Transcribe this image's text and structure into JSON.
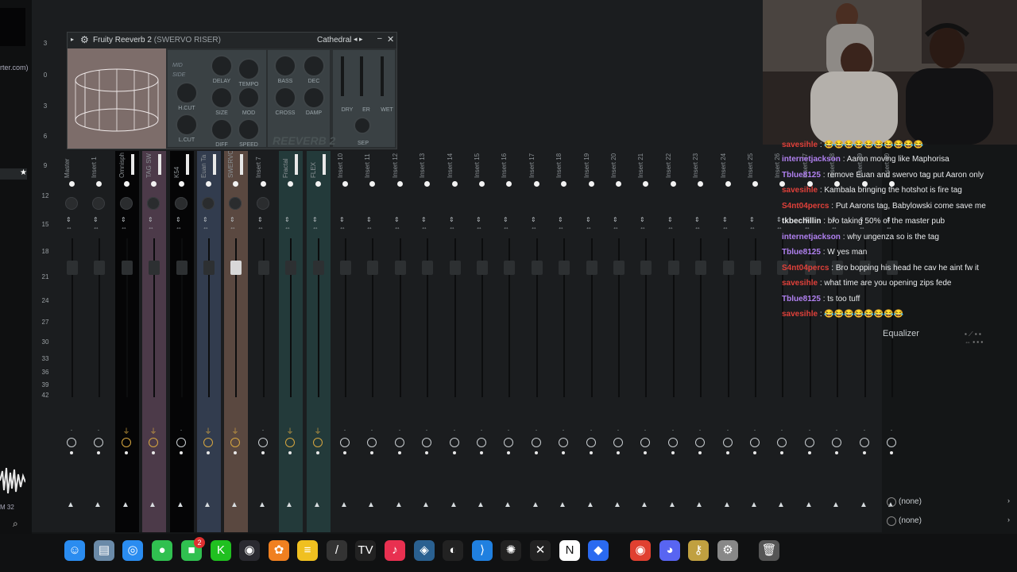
{
  "left_panel": {
    "url_fragment": "rter.com)",
    "star_glyph": "★",
    "zoom_label": "M 32"
  },
  "db_scale": [
    "3",
    "0",
    "3",
    "6",
    "9",
    "12",
    "15",
    "18",
    "21",
    "24",
    "27",
    "30",
    "33",
    "36",
    "39",
    "42"
  ],
  "plugin": {
    "title": "Fruity Reeverb 2",
    "channel": "(SWERVO RISER)",
    "preset": "Cathedral",
    "mode_mid": "MID",
    "mode_side": "SIDE",
    "knob_labels": [
      "DELAY",
      "TEMPO",
      "H.CUT",
      "SIZE",
      "MOD",
      "L.CUT",
      "DIFF",
      "SPEED",
      "BASS",
      "DEC",
      "CROSS",
      "DAMP",
      "DRY",
      "ER",
      "WET"
    ],
    "sep_label": "SEP",
    "brand": "REEVERB 2"
  },
  "mixer": {
    "strips": [
      {
        "name": "Master",
        "color": "dark"
      },
      {
        "name": "Insert 1",
        "color": "dark"
      },
      {
        "name": "Omnisph",
        "color": "black"
      },
      {
        "name": "TAG SW",
        "color": "pink"
      },
      {
        "name": "K54",
        "color": "black"
      },
      {
        "name": "Euan Ta",
        "color": "blue"
      },
      {
        "name": "SWERVO",
        "color": "brown"
      },
      {
        "name": "Insert 7",
        "color": "dark"
      },
      {
        "name": "Fractal",
        "color": "teal"
      },
      {
        "name": "FLEX",
        "color": "teal"
      },
      {
        "name": "Insert 10",
        "color": "dark"
      },
      {
        "name": "Insert 11",
        "color": "dark"
      },
      {
        "name": "Insert 12",
        "color": "dark"
      },
      {
        "name": "Insert 13",
        "color": "dark"
      },
      {
        "name": "Insert 14",
        "color": "dark"
      },
      {
        "name": "Insert 15",
        "color": "dark"
      },
      {
        "name": "Insert 16",
        "color": "dark"
      },
      {
        "name": "Insert 17",
        "color": "dark"
      },
      {
        "name": "Insert 18",
        "color": "dark"
      },
      {
        "name": "Insert 19",
        "color": "dark"
      },
      {
        "name": "Insert 20",
        "color": "dark"
      },
      {
        "name": "Insert 21",
        "color": "dark"
      },
      {
        "name": "Insert 22",
        "color": "dark"
      },
      {
        "name": "Insert 23",
        "color": "dark"
      },
      {
        "name": "Insert 24",
        "color": "dark"
      },
      {
        "name": "Insert 25",
        "color": "dark"
      },
      {
        "name": "Insert 26",
        "color": "dark"
      },
      {
        "name": "Insert 27",
        "color": "dark"
      },
      {
        "name": "Insert 28",
        "color": "dark"
      },
      {
        "name": "Insert 29",
        "color": "dark"
      },
      {
        "name": "Insert 30",
        "color": "dark"
      }
    ]
  },
  "chat": [
    {
      "user": "savesihle",
      "color": "#e0403a",
      "text": "😂😂😂😂😂😂😂😂😂😂"
    },
    {
      "user": "internetjackson",
      "color": "#b080f0",
      "text": "Aaron moving like Maphorisa"
    },
    {
      "user": "Tblue8125",
      "color": "#b080f0",
      "text": "remove Euan and swervo tag put Aaron only"
    },
    {
      "user": "savesihle",
      "color": "#e0403a",
      "text": "Kambala bringing the hotshot is fire tag"
    },
    {
      "user": "S4nt04percs",
      "color": "#e0403a",
      "text": "Put Aarons tag, Babylowski come save me"
    },
    {
      "user": "tkbechillin",
      "color": "#e8eaec",
      "text": "bro taking 50% of the master pub"
    },
    {
      "user": "internetjackson",
      "color": "#b080f0",
      "text": "why ungenza so is the tag"
    },
    {
      "user": "Tblue8125",
      "color": "#b080f0",
      "text": "W yes man"
    },
    {
      "user": "S4nt04percs",
      "color": "#e0403a",
      "text": "Bro bopping his head he cav he aint fw it"
    },
    {
      "user": "savesihle",
      "color": "#e0403a",
      "text": "what time are you opening zips fede"
    },
    {
      "user": "Tblue8125",
      "color": "#b080f0",
      "text": "ts too tuff"
    },
    {
      "user": "savesihle",
      "color": "#e0403a",
      "text": "😂😂😂😂😂😂😂😂"
    }
  ],
  "right_panel": {
    "eq_label": "Equalizer",
    "slot1": "(none)",
    "slot2": "(none)"
  },
  "dock": [
    {
      "name": "finder",
      "glyph": "☺",
      "color": "#2a8cf0"
    },
    {
      "name": "files",
      "glyph": "▤",
      "color": "#6a8aa8"
    },
    {
      "name": "safari",
      "glyph": "◎",
      "color": "#2a8cf0"
    },
    {
      "name": "messages",
      "glyph": "●",
      "color": "#30c050"
    },
    {
      "name": "facetime",
      "glyph": "■",
      "color": "#30c050"
    },
    {
      "name": "kick",
      "glyph": "K",
      "color": "#20c020"
    },
    {
      "name": "obs",
      "glyph": "◉",
      "color": "#2a2a30"
    },
    {
      "name": "fl-studio",
      "glyph": "✿",
      "color": "#f08020"
    },
    {
      "name": "notes",
      "glyph": "≡",
      "color": "#f0c020"
    },
    {
      "name": "pen",
      "glyph": "/",
      "color": "#333"
    },
    {
      "name": "tradingview",
      "glyph": "TV",
      "color": "#222"
    },
    {
      "name": "music",
      "glyph": "♪",
      "color": "#e83050"
    },
    {
      "name": "davinci",
      "glyph": "◈",
      "color": "#2a6090"
    },
    {
      "name": "github",
      "glyph": "◐",
      "color": "#222"
    },
    {
      "name": "vscode",
      "glyph": "⟩",
      "color": "#2080e0"
    },
    {
      "name": "chatgpt",
      "glyph": "✺",
      "color": "#222"
    },
    {
      "name": "capcut",
      "glyph": "✕",
      "color": "#222"
    },
    {
      "name": "notion",
      "glyph": "N",
      "color": "#fff"
    },
    {
      "name": "app-store",
      "glyph": "◆",
      "color": "#2a6af0"
    },
    {
      "name": "chrome",
      "glyph": "◉",
      "color": "#e04030"
    },
    {
      "name": "discord",
      "glyph": "◕",
      "color": "#5865f2"
    },
    {
      "name": "keychain",
      "glyph": "⚷",
      "color": "#c0a040"
    },
    {
      "name": "settings",
      "glyph": "⚙",
      "color": "#888"
    },
    {
      "name": "trash",
      "glyph": "🗑",
      "color": "#555"
    }
  ],
  "dock_badge": "2"
}
